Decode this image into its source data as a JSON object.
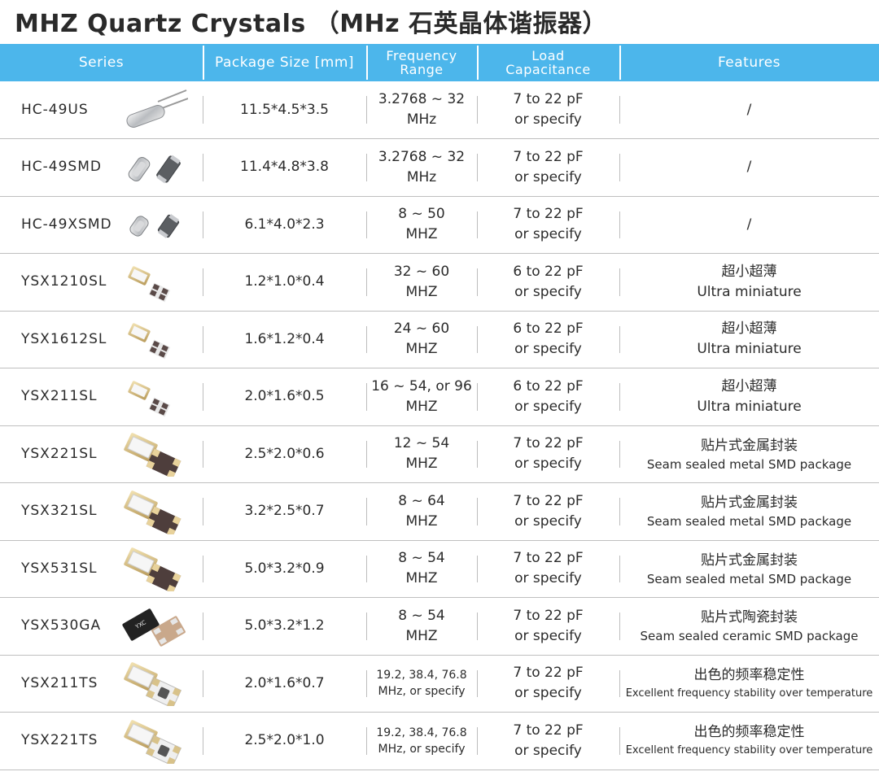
{
  "title": "MHZ Quartz Crystals （MHz 石英晶体谐振器）",
  "header": {
    "series": "Series",
    "package": "Package Size [mm]",
    "frequency_1": "Frequency",
    "frequency_2": "Range",
    "load_1": "Load",
    "load_2": "Capacitance",
    "features": "Features"
  },
  "colors": {
    "header_bg": "#4cb6eb"
  },
  "rows": [
    {
      "series": "HC-49US",
      "icon": "hc49us-crystal-icon",
      "size": "11.5*4.5*3.5",
      "freq1": "3.2768 ~ 32",
      "freq2": "MHz",
      "load1": "7 to 22 pF",
      "load2": "or specify",
      "feat1": "/",
      "feat2": ""
    },
    {
      "series": "HC-49SMD",
      "icon": "hc49smd-crystal-icon",
      "size": "11.4*4.8*3.8",
      "freq1": "3.2768 ~ 32",
      "freq2": "MHz",
      "load1": "7 to 22 pF",
      "load2": "or specify",
      "feat1": "/",
      "feat2": ""
    },
    {
      "series": "HC-49XSMD",
      "icon": "hc49xsmd-crystal-icon",
      "size": "6.1*4.0*2.3",
      "freq1": "8 ~ 50",
      "freq2": "MHZ",
      "load1": "7 to 22 pF",
      "load2": "or specify",
      "feat1": "/",
      "feat2": ""
    },
    {
      "series": "YSX1210SL",
      "icon": "ysx1210sl-crystal-icon",
      "size": "1.2*1.0*0.4",
      "freq1": "32 ~ 60",
      "freq2": "MHZ",
      "load1": "6 to 22 pF",
      "load2": "or specify",
      "feat1": "超小超薄",
      "feat2": "Ultra miniature"
    },
    {
      "series": "YSX1612SL",
      "icon": "ysx1612sl-crystal-icon",
      "size": "1.6*1.2*0.4",
      "freq1": "24 ~ 60",
      "freq2": "MHZ",
      "load1": "6 to 22 pF",
      "load2": "or specify",
      "feat1": "超小超薄",
      "feat2": "Ultra miniature"
    },
    {
      "series": "YSX211SL",
      "icon": "ysx211sl-crystal-icon",
      "size": "2.0*1.6*0.5",
      "freq1": "16 ~ 54, or 96",
      "freq2": "MHZ",
      "load1": "6 to 22 pF",
      "load2": "or specify",
      "feat1": "超小超薄",
      "feat2": "Ultra miniature"
    },
    {
      "series": "YSX221SL",
      "icon": "ysx221sl-crystal-icon",
      "size": "2.5*2.0*0.6",
      "freq1": "12 ~ 54",
      "freq2": "MHZ",
      "load1": "7 to 22 pF",
      "load2": "or specify",
      "feat1": "贴片式金属封装",
      "feat2": "Seam sealed metal SMD package"
    },
    {
      "series": "YSX321SL",
      "icon": "ysx321sl-crystal-icon",
      "size": "3.2*2.5*0.7",
      "freq1": "8 ~ 64",
      "freq2": "MHZ",
      "load1": "7 to 22 pF",
      "load2": "or specify",
      "feat1": "贴片式金属封装",
      "feat2": "Seam sealed metal SMD package"
    },
    {
      "series": "YSX531SL",
      "icon": "ysx531sl-crystal-icon",
      "size": "5.0*3.2*0.9",
      "freq1": "8 ~ 54",
      "freq2": "MHZ",
      "load1": "7 to 22 pF",
      "load2": "or specify",
      "feat1": "贴片式金属封装",
      "feat2": "Seam sealed metal SMD package"
    },
    {
      "series": "YSX530GA",
      "icon": "ysx530ga-crystal-icon",
      "size": "5.0*3.2*1.2",
      "freq1": "8 ~ 54",
      "freq2": "MHZ",
      "load1": "7 to 22 pF",
      "load2": "or specify",
      "feat1": "贴片式陶瓷封装",
      "feat2": "Seam sealed ceramic SMD package"
    },
    {
      "series": "YSX211TS",
      "icon": "ysx211ts-crystal-icon",
      "size": "2.0*1.6*0.7",
      "freq1": "19.2, 38.4, 76.8",
      "freq2": "MHz, or specify",
      "load1": "7 to 22 pF",
      "load2": "or specify",
      "feat1": "出色的频率稳定性",
      "feat2": "Excellent frequency stability over temperature"
    },
    {
      "series": "YSX221TS",
      "icon": "ysx221ts-crystal-icon",
      "size": "2.5*2.0*1.0",
      "freq1": "19.2, 38.4, 76.8",
      "freq2": "MHz, or specify",
      "load1": "7 to 22 pF",
      "load2": "or specify",
      "feat1": "出色的频率稳定性",
      "feat2": "Excellent frequency stability over temperature"
    }
  ]
}
